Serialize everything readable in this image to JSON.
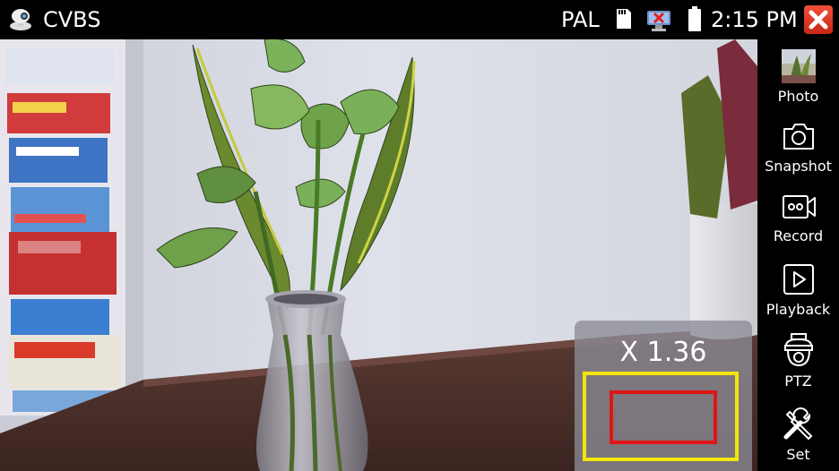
{
  "status_bar": {
    "app_title": "CVBS",
    "app_icon": "camera-icon",
    "signal_standard": "PAL",
    "sd_icon": "sd-card-icon",
    "network_icon": "network-disconnected-icon",
    "battery_icon": "battery-icon",
    "time": "2:15 PM",
    "close_icon": "close-icon"
  },
  "zoom": {
    "label": "X 1.36",
    "frame_color": "#f2e60a",
    "roi_color": "#e01515"
  },
  "toolbar": {
    "items": [
      {
        "label": "Photo",
        "icon": "photo-thumbnail-icon"
      },
      {
        "label": "Snapshot",
        "icon": "camera-snapshot-icon"
      },
      {
        "label": "Record",
        "icon": "record-icon"
      },
      {
        "label": "Playback",
        "icon": "playback-icon"
      },
      {
        "label": "PTZ",
        "icon": "ptz-camera-icon"
      },
      {
        "label": "Set",
        "icon": "tools-icon"
      }
    ]
  },
  "colors": {
    "bar_background": "#000000",
    "close_button": "#d8341f"
  }
}
